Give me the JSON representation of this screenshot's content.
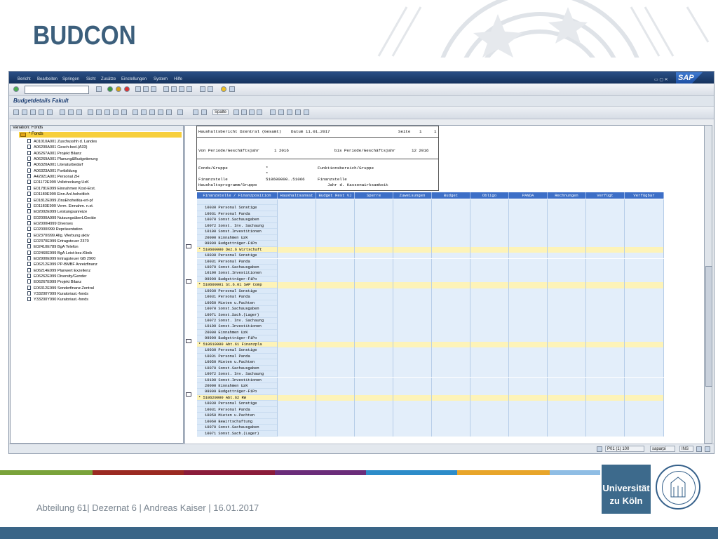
{
  "slide": {
    "title": "BUDCON",
    "footer": "Abteilung 61| Dezernat 6 | Andreas Kaiser  | 16.01.2017",
    "logo_line1": "Universität",
    "logo_line2": "zu Köln",
    "accent_color": "#3c5f7c"
  },
  "sap": {
    "menu": [
      "Bericht",
      "Bearbeiten",
      "Springen",
      "Sicht",
      "Zusätze",
      "Einstellungen",
      "System",
      "Hilfe"
    ],
    "logo_text": "SAP",
    "screen_title": "Budgetdetails Fakult",
    "spalte_label": "Spalte",
    "tree": {
      "header": "Variation: Fonds",
      "root": "* Fonds",
      "items": [
        "A01010A001 Zuschusshh d. Landes",
        "A06200A001 Gesch-bed.(A33)",
        "A06267A001 Projekt Bilanz",
        "A06269A001 Planung&Budgetierung",
        "A06320A001 Literaturbedarf",
        "A06323A001 Fortbildung",
        "A42921A001 Personal ZH",
        "E01172E999 Vollstreckung UzK",
        "E01781E999 Einnahmen Kost-Erst.",
        "E01180E999 Einn.Anl.hoheitlich",
        "E01812E999 ZinsEhoheitka-ert-pf",
        "E01183E999 Verm. Einnahm. n.st.",
        "E02002E999 Leistungsanreize",
        "E02000A999 NutzungsüberLGeräte",
        "E02000H999 Diverses",
        "E02000I999 Repräsentation",
        "E02370I999 Allg. Werbung aktiv",
        "E02370E999 Ertragsteuer 2370",
        "E02410E789 BgA Telefon",
        "E02460E999 BgA Leist-bez.Klinik",
        "E02900E999 Ertragsteuer GB 2900",
        "E06212E999 PP-BMBF Anreizfinanz",
        "E06214E999 Planwert Exzellenz",
        "E06262E999 Diversity/Gender",
        "E06267E999 Projekt Bilanz",
        "E06312E999 Sonderfinanz.Zentral",
        "Y33200Y999 Kuratoriast.-fonds",
        "Y33200Y990 Kuratoriast.-fonds"
      ]
    },
    "report": {
      "header_title": "Haushaltsbericht Dzentral (Gesamt)",
      "datum": "Datum 11.01.2017",
      "seite_label": "Seite",
      "seite_num": "1",
      "seite_total": "1",
      "von_label": "Von Periode/Geschäftsjahr",
      "von_value": "1 2016",
      "bis_label": "bis Periode/Geschäftsjahr",
      "bis_value": "12 2016",
      "fonds_label": "Fonds/Gruppe",
      "fonds_value": "*",
      "fb_label": "Funktionsbereich/Gruppe",
      "star2": "*",
      "fst_label": "Finanzstelle",
      "fst_value": "510600000..51066",
      "fst_suffix": "Finanzstelle",
      "hhp_label": "Haushaltsprogramm/Gruppe",
      "kw_label": "Jahr d. Kassenwirksamkeit"
    },
    "columns": [
      "Finanzstelle / Finanzposition",
      "Haushaltsansat",
      "Budget Rest VJ",
      "Sperre",
      "Zuweisungen",
      "Budget",
      "Obligo",
      "PANDA",
      "Rechnungen",
      "Verfügt",
      "Verfügbar"
    ],
    "rows": [
      {
        "type": "leaf",
        "text": ""
      },
      {
        "type": "leaf",
        "text": "10030  Personal Sonstige"
      },
      {
        "type": "leaf",
        "text": "10031  Personal Panda"
      },
      {
        "type": "leaf",
        "text": "10070  Sonst.Sachausgaben"
      },
      {
        "type": "leaf",
        "text": "10072  Sonst. Inv. Sachaung"
      },
      {
        "type": "leaf",
        "text": "10100  Sonst.Investitionen"
      },
      {
        "type": "leaf",
        "text": "20000  Einnahmen UzK"
      },
      {
        "type": "leaf",
        "text": "99999  Budgetträger-FiPo"
      },
      {
        "type": "sum",
        "text": "*  510600000  Dez.6 Wirtschaft"
      },
      {
        "type": "leaf",
        "text": "10030  Personal Sonstige"
      },
      {
        "type": "leaf",
        "text": "10031  Personal Panda"
      },
      {
        "type": "leaf",
        "text": "10070  Sonst.Sachausgaben"
      },
      {
        "type": "leaf",
        "text": "10100  Sonst.Investitionen"
      },
      {
        "type": "leaf",
        "text": "99999  Budgetträger-FiPo"
      },
      {
        "type": "sum",
        "text": "*  510600001  St.6.01 SAP Comp"
      },
      {
        "type": "leaf",
        "text": "10030  Personal Sonstige"
      },
      {
        "type": "leaf",
        "text": "10031  Personal Panda"
      },
      {
        "type": "leaf",
        "text": "10050  Mieten u.Pachten"
      },
      {
        "type": "leaf",
        "text": "10070  Sonst.Sachausgaben"
      },
      {
        "type": "leaf",
        "text": "10071  Sonst.Sach.(Lager)"
      },
      {
        "type": "leaf",
        "text": "10072  Sonst. Inv. Sachaung"
      },
      {
        "type": "leaf",
        "text": "10100  Sonst.Investitionen"
      },
      {
        "type": "leaf",
        "text": "20000  Einnahmen UzK"
      },
      {
        "type": "leaf",
        "text": "99999  Budgetträger-FiPo"
      },
      {
        "type": "sum",
        "text": "*  510610000  Abt.61 Finanzpla"
      },
      {
        "type": "leaf",
        "text": "10030  Personal Sonstige"
      },
      {
        "type": "leaf",
        "text": "10031  Personal Panda"
      },
      {
        "type": "leaf",
        "text": "10050  Mieten u.Pachten"
      },
      {
        "type": "leaf",
        "text": "10070  Sonst.Sachausgaben"
      },
      {
        "type": "leaf",
        "text": "10072  Sonst. Inv. Sachaung"
      },
      {
        "type": "leaf",
        "text": "10100  Sonst.Investitionen"
      },
      {
        "type": "leaf",
        "text": "20000  Einnahmen UzK"
      },
      {
        "type": "leaf",
        "text": "99999  Budgetträger-FiPo"
      },
      {
        "type": "sum",
        "text": "*  510620000  Abt.62 RW"
      },
      {
        "type": "leaf",
        "text": "10030  Personal Sonstige"
      },
      {
        "type": "leaf",
        "text": "10031  Personal Panda"
      },
      {
        "type": "leaf",
        "text": "10050  Mieten u.Pachten"
      },
      {
        "type": "leaf",
        "text": "10060  Bewirtschaftung"
      },
      {
        "type": "leaf",
        "text": "10070  Sonst.Sachausgaben"
      },
      {
        "type": "leaf",
        "text": "10071  Sonst.Sach.(Lager)"
      }
    ],
    "status": {
      "session": "P01 (1) 100",
      "server": "saparpi",
      "mode": "INS"
    }
  }
}
